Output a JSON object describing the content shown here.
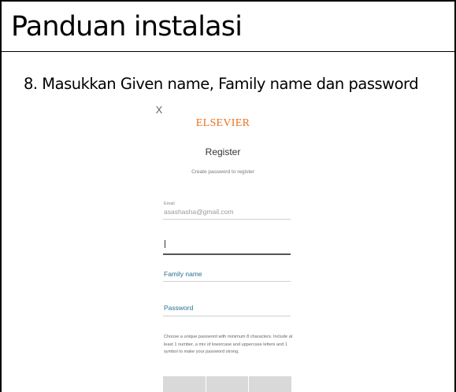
{
  "slide": {
    "title": "Panduan instalasi",
    "step": "8. Masukkan Given name, Family name dan password"
  },
  "dialog": {
    "close_label": "X",
    "brand": "ELSEVIER",
    "heading": "Register",
    "subheading": "Create password to register",
    "email": {
      "label": "Email",
      "value": "asashasha@gmail.com"
    },
    "given_name": {
      "value": ""
    },
    "family_name": {
      "placeholder": "Family name"
    },
    "password": {
      "placeholder": "Password"
    },
    "help_text": "Choose a unique password with minimum 8 characters. Include at least 1 number, a mix of lowercase and uppercase letters and 1 symbol to make your password strong.",
    "colors": {
      "brand": "#e9711c",
      "placeholder": "#2a6f8f",
      "button": "#d9d9d9"
    }
  }
}
